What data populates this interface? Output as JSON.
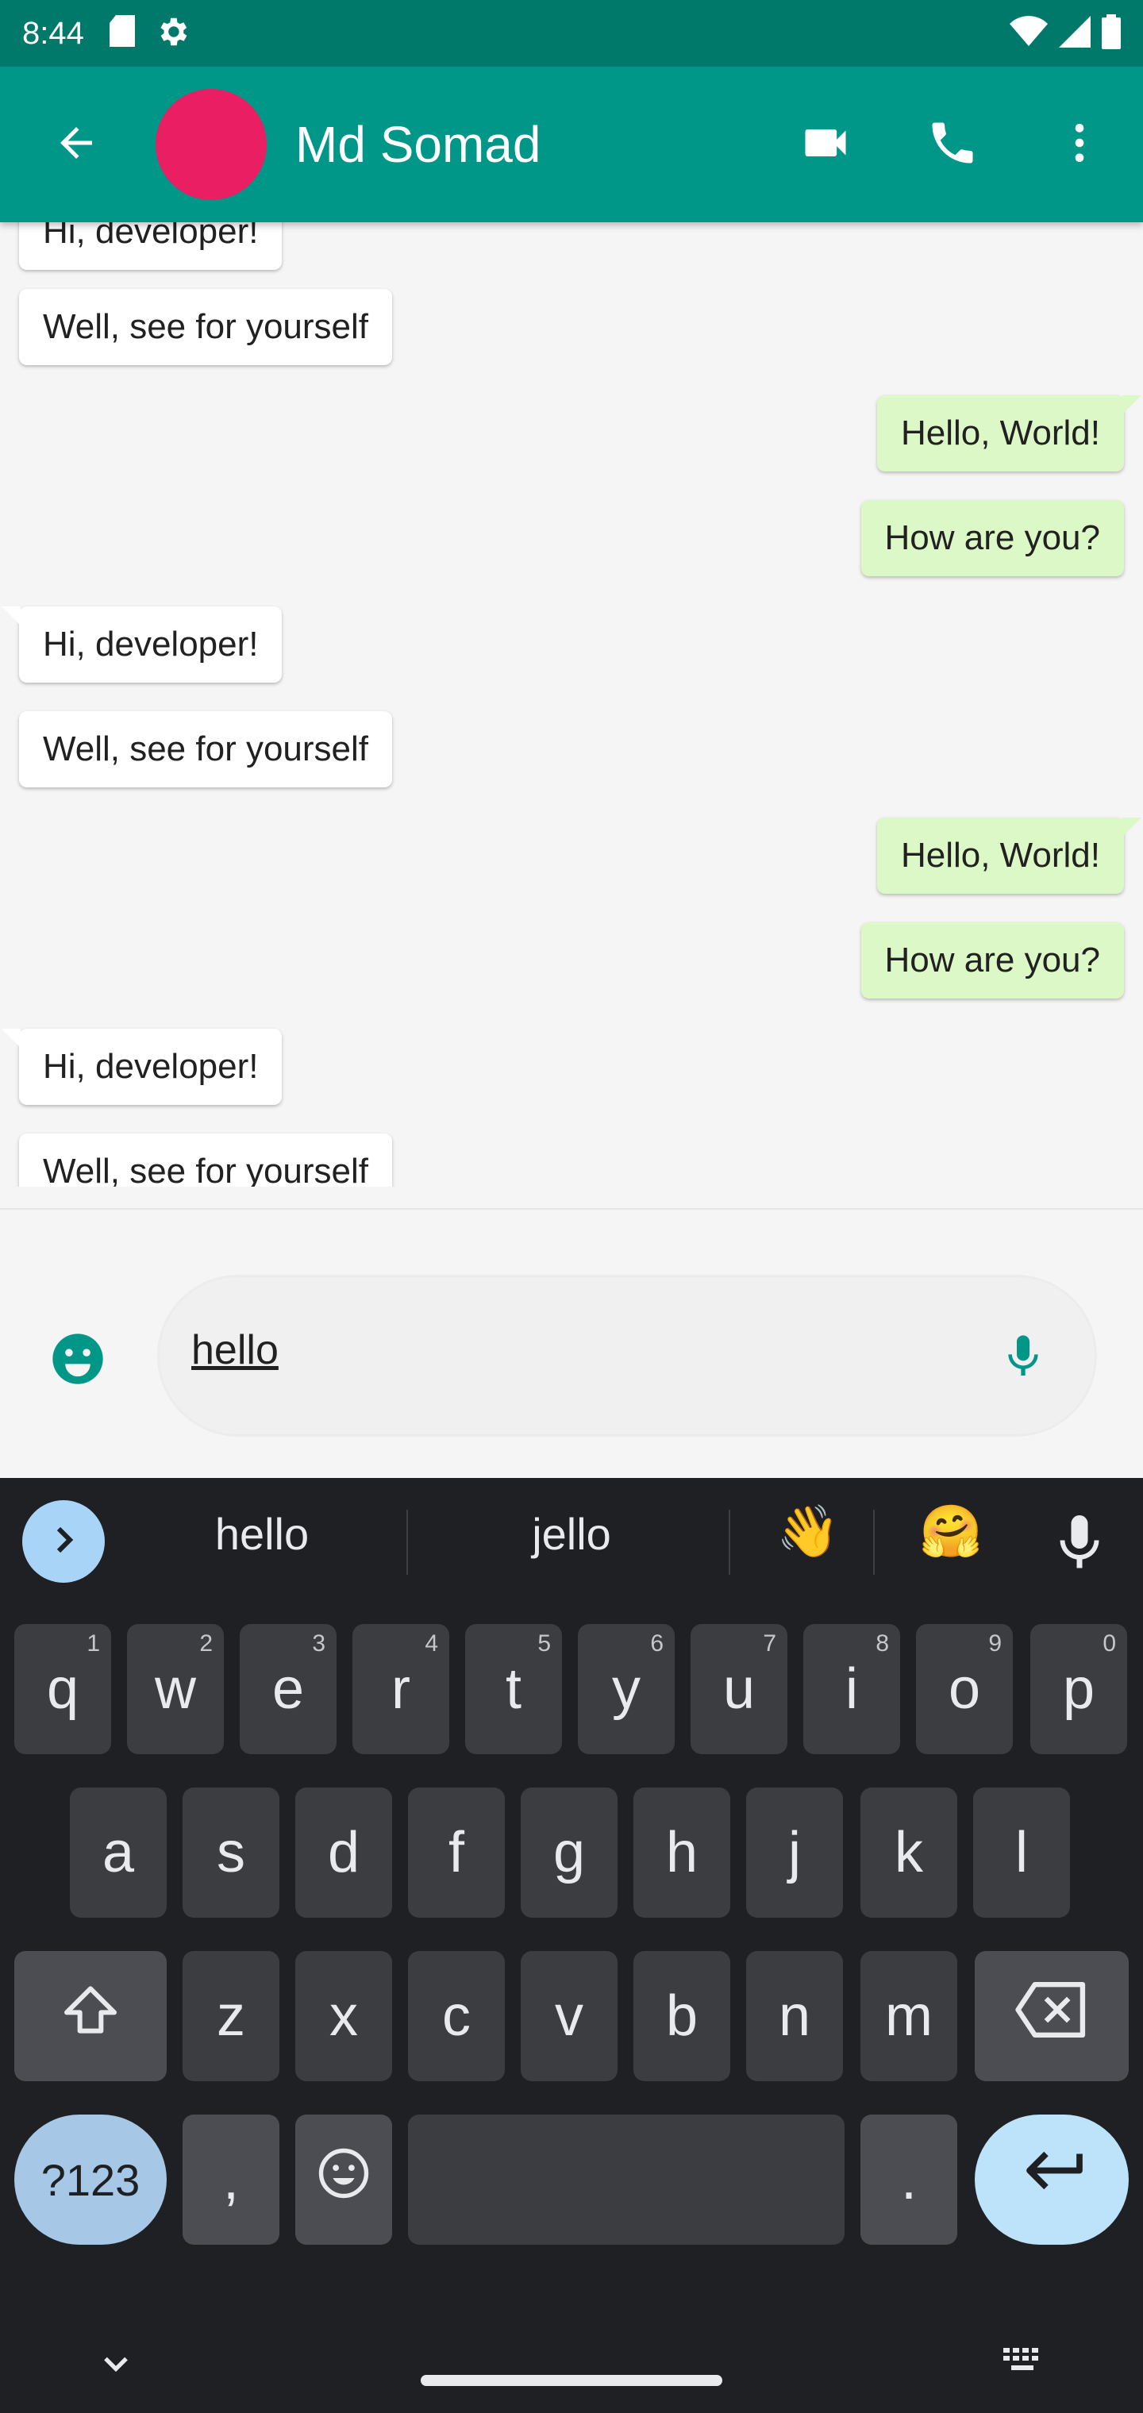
{
  "status_bar": {
    "time": "8:44"
  },
  "app_bar": {
    "contact_name": "Md Somad"
  },
  "messages": [
    {
      "text": "Hi, developer!",
      "dir": "in"
    },
    {
      "text": "Well, see for yourself",
      "dir": "in"
    },
    {
      "text": "Hello, World!",
      "dir": "out"
    },
    {
      "text": "How are you?",
      "dir": "out"
    },
    {
      "text": "Hi, developer!",
      "dir": "in"
    },
    {
      "text": "Well, see for yourself",
      "dir": "in"
    },
    {
      "text": "Hello, World!",
      "dir": "out"
    },
    {
      "text": "How are you?",
      "dir": "out"
    },
    {
      "text": "Hi, developer!",
      "dir": "in"
    },
    {
      "text": "Well, see for yourself",
      "dir": "in"
    }
  ],
  "composer": {
    "value": "hello"
  },
  "keyboard": {
    "suggestions": [
      "hello",
      "jello"
    ],
    "emoji_suggestions": [
      "👋",
      "🤗"
    ],
    "row1": [
      {
        "label": "q",
        "hint": "1"
      },
      {
        "label": "w",
        "hint": "2"
      },
      {
        "label": "e",
        "hint": "3"
      },
      {
        "label": "r",
        "hint": "4"
      },
      {
        "label": "t",
        "hint": "5"
      },
      {
        "label": "y",
        "hint": "6"
      },
      {
        "label": "u",
        "hint": "7"
      },
      {
        "label": "i",
        "hint": "8"
      },
      {
        "label": "o",
        "hint": "9"
      },
      {
        "label": "p",
        "hint": "0"
      }
    ],
    "row2": [
      "a",
      "s",
      "d",
      "f",
      "g",
      "h",
      "j",
      "k",
      "l"
    ],
    "row3": [
      "z",
      "x",
      "c",
      "v",
      "b",
      "n",
      "m"
    ],
    "symbols_label": "?123",
    "comma_label": ",",
    "period_label": "."
  },
  "colors": {
    "app_bar": "#009688",
    "status_bar": "#00796b",
    "avatar": "#e91e63",
    "outgoing_bubble": "#dcf8c6",
    "incoming_bubble": "#ffffff",
    "keyboard_bg": "#1f2023"
  }
}
